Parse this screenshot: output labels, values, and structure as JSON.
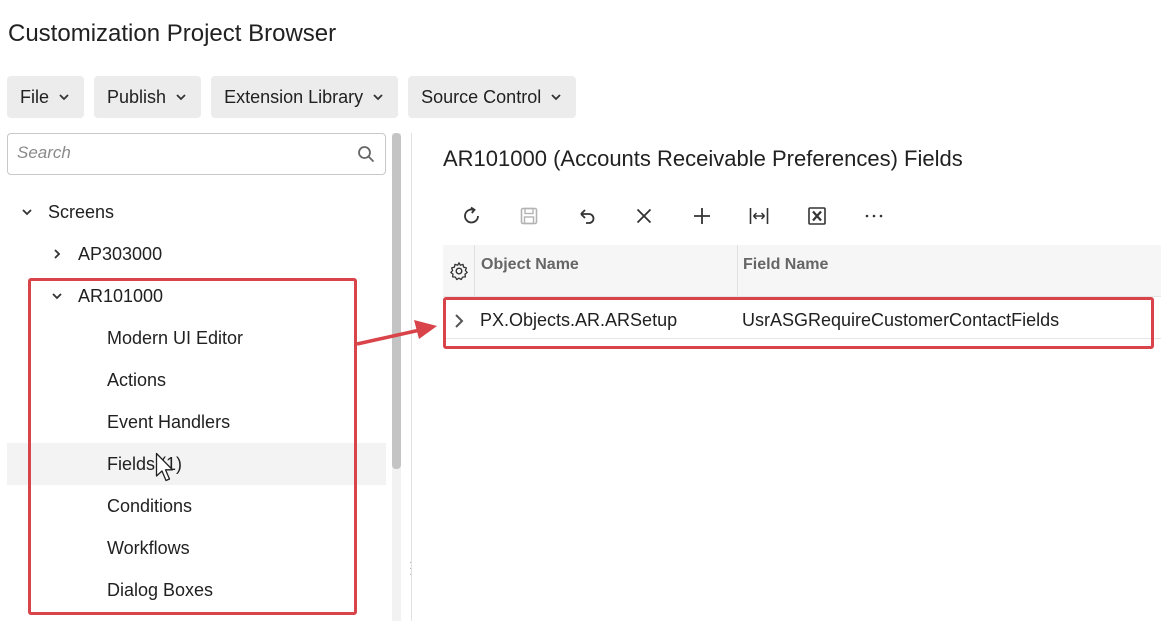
{
  "page": {
    "title": "Customization Project Browser"
  },
  "menubar": {
    "items": [
      {
        "label": "File"
      },
      {
        "label": "Publish"
      },
      {
        "label": "Extension Library"
      },
      {
        "label": "Source Control"
      }
    ]
  },
  "sidebar": {
    "search_placeholder": "Search",
    "tree": {
      "root_label": "Screens",
      "screens": [
        {
          "label": "AP303000",
          "expanded": false
        },
        {
          "label": "AR101000",
          "expanded": true
        }
      ],
      "children": [
        {
          "label": "Modern UI Editor"
        },
        {
          "label": "Actions"
        },
        {
          "label": "Event Handlers"
        },
        {
          "label": "Fields (1)"
        },
        {
          "label": "Conditions"
        },
        {
          "label": "Workflows"
        },
        {
          "label": "Dialog Boxes"
        }
      ]
    }
  },
  "main": {
    "title": "AR101000 (Accounts Receivable Preferences) Fields",
    "toolbar": [
      "refresh-icon",
      "save-icon",
      "undo-icon",
      "delete-icon",
      "add-icon",
      "fit-columns-icon",
      "export-excel-icon",
      "more-icon"
    ],
    "grid": {
      "columns": [
        "Object Name",
        "Field Name"
      ],
      "rows": [
        {
          "object_name": "PX.Objects.AR.ARSetup",
          "field_name": "UsrASGRequireCustomerContactFields"
        }
      ]
    }
  },
  "colors": {
    "highlight": "#d9434a",
    "button_bg": "#ececec"
  }
}
